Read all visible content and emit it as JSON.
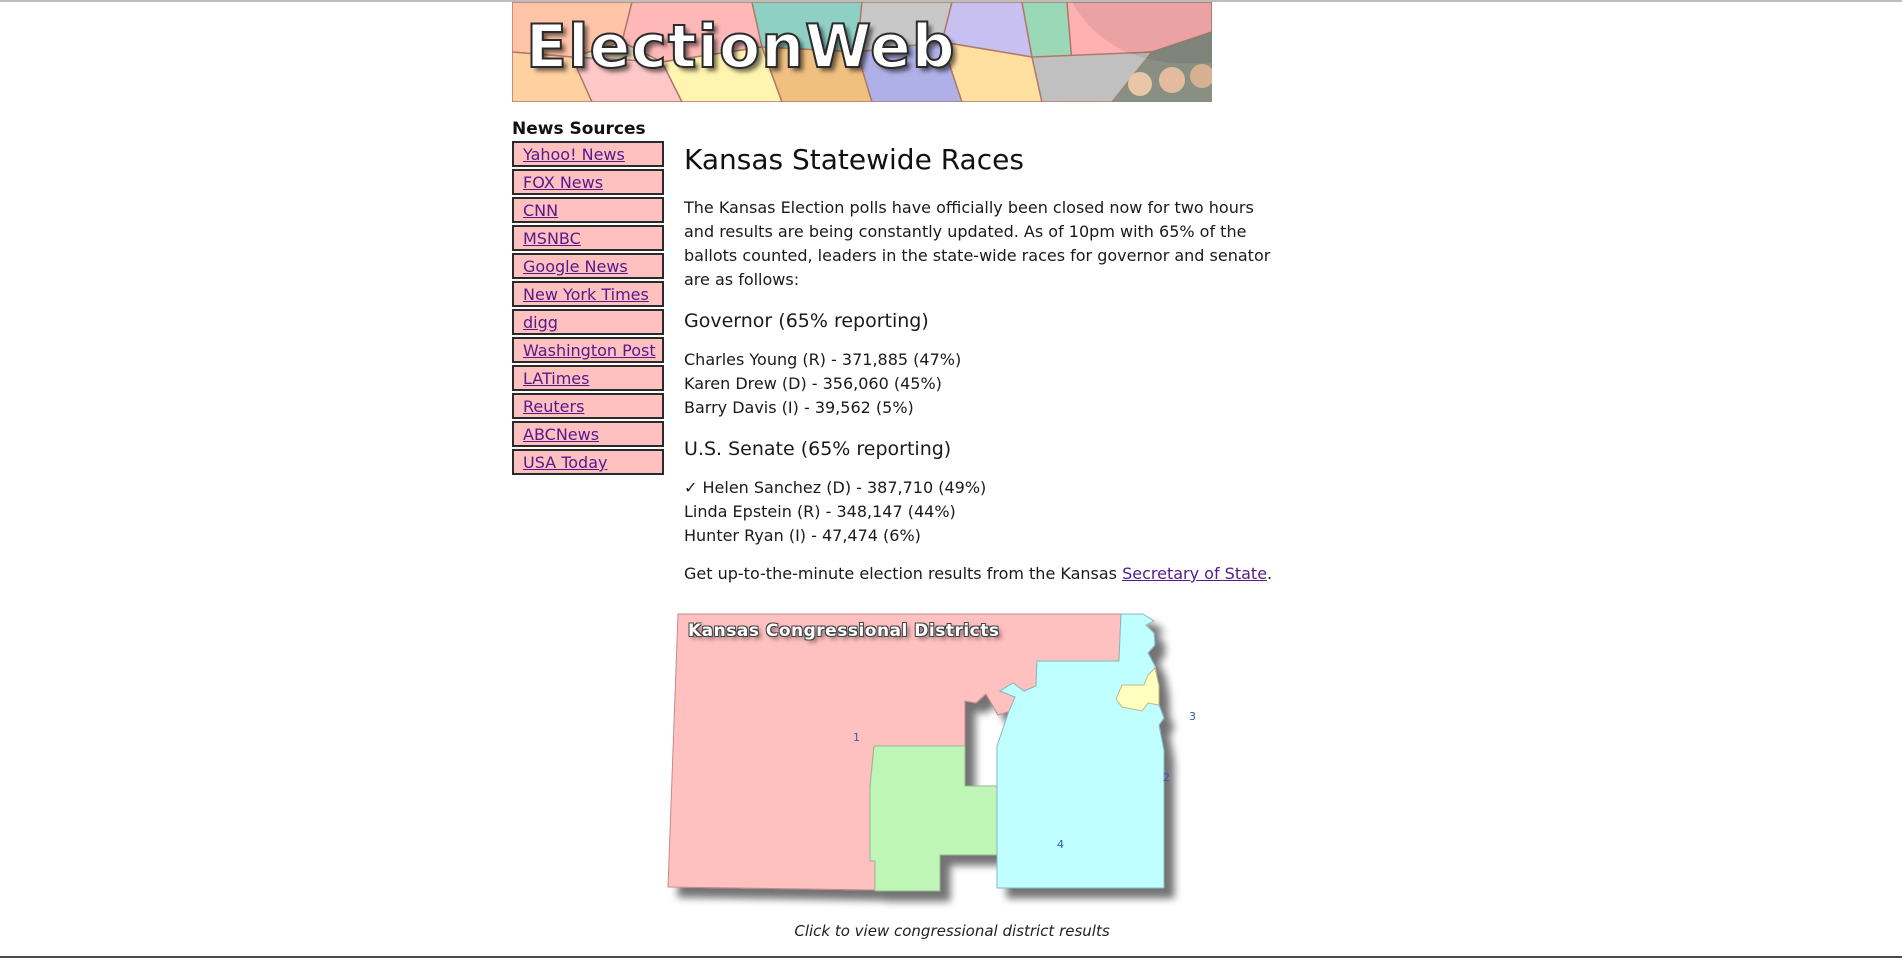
{
  "banner": {
    "title": "ElectionWeb"
  },
  "sidebar": {
    "heading": "News Sources",
    "items": [
      {
        "label": "Yahoo! News"
      },
      {
        "label": "FOX News"
      },
      {
        "label": "CNN"
      },
      {
        "label": "MSNBC"
      },
      {
        "label": "Google News"
      },
      {
        "label": "New York Times"
      },
      {
        "label": "digg"
      },
      {
        "label": "Washington Post"
      },
      {
        "label": "LATimes"
      },
      {
        "label": "Reuters"
      },
      {
        "label": "ABCNews"
      },
      {
        "label": "USA Today"
      }
    ]
  },
  "main": {
    "title": "Kansas Statewide Races",
    "intro": "The Kansas Election polls have officially been closed now for two hours and results are being constantly updated. As of 10pm with 65% of the ballots counted, leaders in the state-wide races for governor and senator are as follows:",
    "governor": {
      "title": "Governor (65% reporting)",
      "results": [
        "Charles Young (R) - 371,885 (47%)",
        "Karen Drew (D) - 356,060 (45%)",
        "Barry Davis (I) - 39,562 (5%)"
      ]
    },
    "senate": {
      "title": "U.S. Senate (65% reporting)",
      "results": [
        "✓ Helen Sanchez (D) - 387,710 (49%)",
        "Linda Epstein (R) - 348,147 (44%)",
        "Hunter Ryan (I) - 47,474 (6%)"
      ]
    },
    "footer_prefix": "Get up-to-the-minute election results from the Kansas ",
    "footer_link": "Secretary of State",
    "footer_suffix": "."
  },
  "map": {
    "title": "Kansas Congressional Districts",
    "districts": [
      "1",
      "2",
      "3",
      "4"
    ],
    "colors": {
      "d1": "#ffc0c0",
      "d2": "#c0ffff",
      "d3": "#ffffc0",
      "d4": "#c0f5b8"
    },
    "caption": "Click to view congressional district results"
  },
  "colors": {
    "link": "#551a8b",
    "sidebar_bg": "#ffc0c0"
  }
}
